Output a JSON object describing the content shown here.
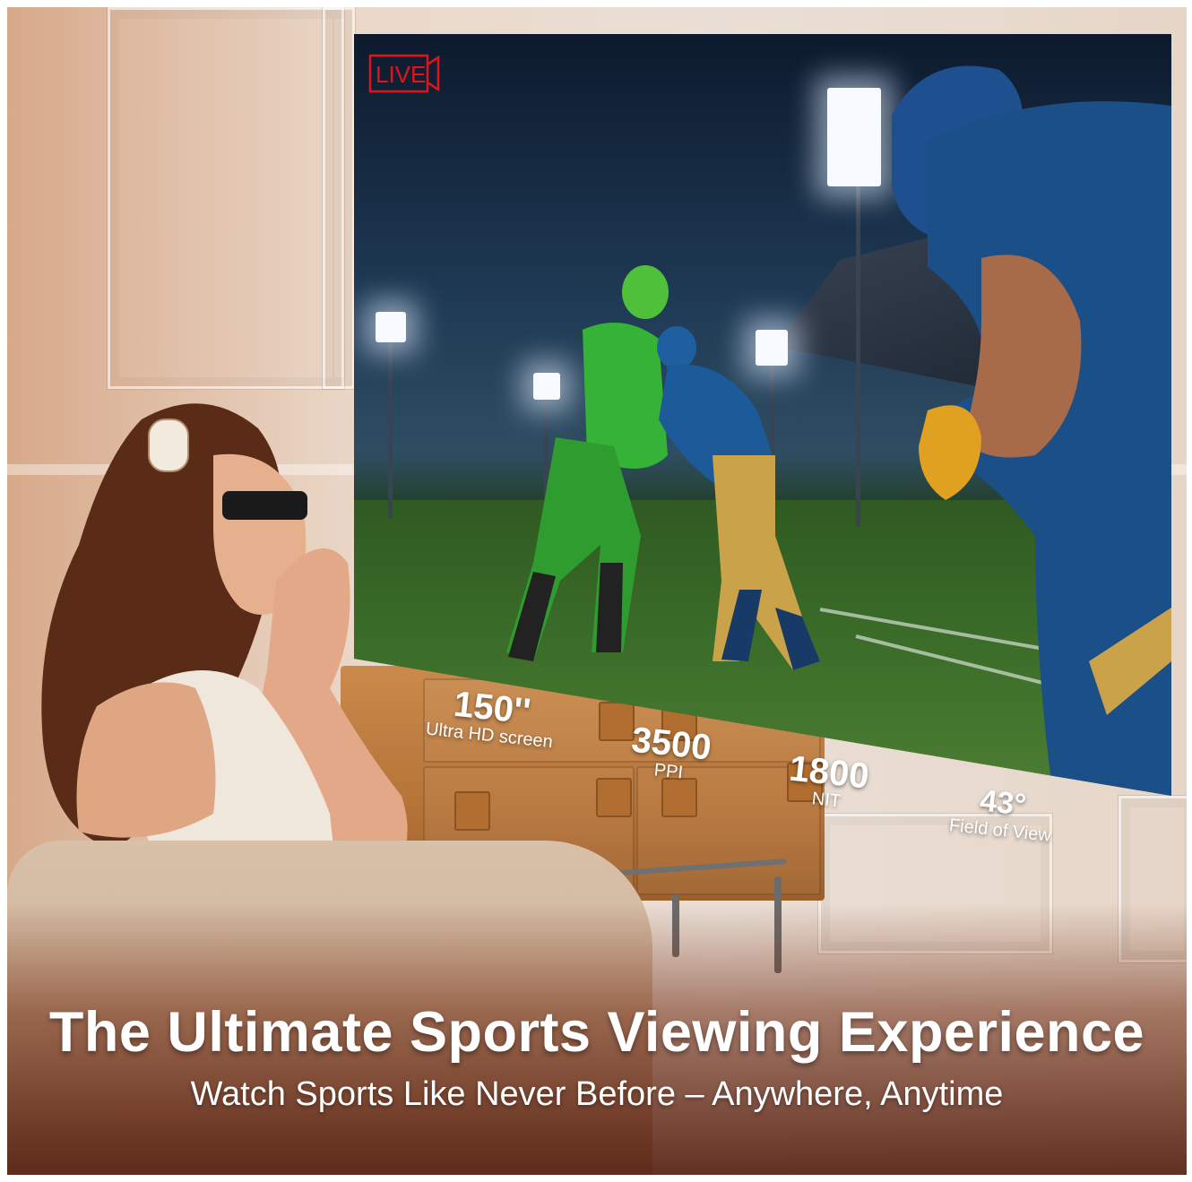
{
  "screen": {
    "live_label": "LIVE"
  },
  "specs": [
    {
      "value": "150''",
      "label": "Ultra HD screen"
    },
    {
      "value": "3500",
      "label": "PPI"
    },
    {
      "value": "1800",
      "label": "NIT"
    },
    {
      "value": "43°",
      "label": "Field of View"
    }
  ],
  "headline": "The Ultimate Sports Viewing Experience",
  "subheadline": "Watch Sports Like Never Before – Anywhere, Anytime",
  "colors": {
    "live_red": "#e1141b",
    "text": "#ffffff",
    "green_jersey": "#35b33a",
    "blue_jersey": "#1d5a9a",
    "gold": "#c9a24a"
  },
  "icons": [
    "live-badge-icon"
  ]
}
